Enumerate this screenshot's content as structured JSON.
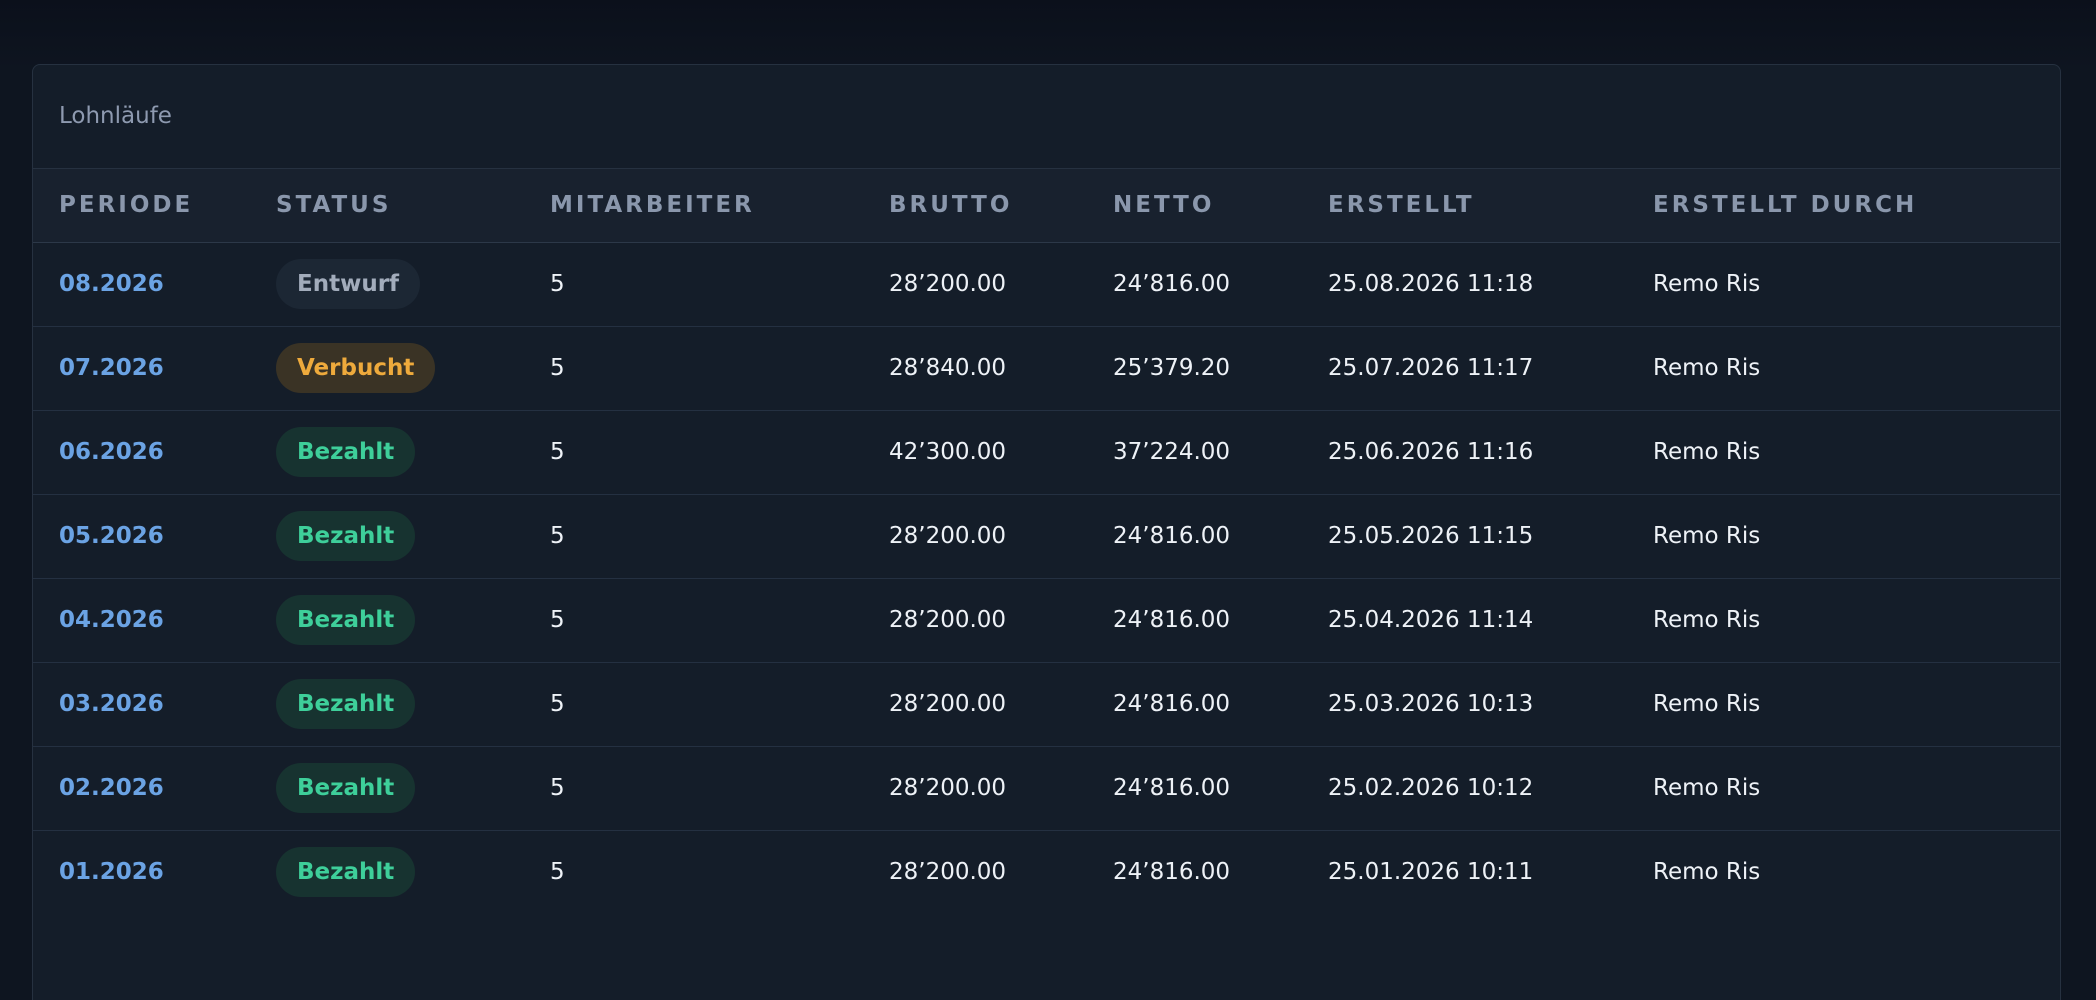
{
  "card": {
    "title": "Lohnläufe"
  },
  "table": {
    "headers": [
      "PERIODE",
      "STATUS",
      "MITARBEITER",
      "BRUTTO",
      "NETTO",
      "ERSTELLT",
      "ERSTELLT DURCH"
    ],
    "rows": [
      {
        "period": "08.2026",
        "status": "Entwurf",
        "status_kind": "draft",
        "employees": "5",
        "gross": "28’200.00",
        "net": "24’816.00",
        "created": "25.08.2026 11:18",
        "created_by": "Remo Ris"
      },
      {
        "period": "07.2026",
        "status": "Verbucht",
        "status_kind": "booked",
        "employees": "5",
        "gross": "28’840.00",
        "net": "25’379.20",
        "created": "25.07.2026 11:17",
        "created_by": "Remo Ris"
      },
      {
        "period": "06.2026",
        "status": "Bezahlt",
        "status_kind": "paid",
        "employees": "5",
        "gross": "42’300.00",
        "net": "37’224.00",
        "created": "25.06.2026 11:16",
        "created_by": "Remo Ris"
      },
      {
        "period": "05.2026",
        "status": "Bezahlt",
        "status_kind": "paid",
        "employees": "5",
        "gross": "28’200.00",
        "net": "24’816.00",
        "created": "25.05.2026 11:15",
        "created_by": "Remo Ris"
      },
      {
        "period": "04.2026",
        "status": "Bezahlt",
        "status_kind": "paid",
        "employees": "5",
        "gross": "28’200.00",
        "net": "24’816.00",
        "created": "25.04.2026 11:14",
        "created_by": "Remo Ris"
      },
      {
        "period": "03.2026",
        "status": "Bezahlt",
        "status_kind": "paid",
        "employees": "5",
        "gross": "28’200.00",
        "net": "24’816.00",
        "created": "25.03.2026 10:13",
        "created_by": "Remo Ris"
      },
      {
        "period": "02.2026",
        "status": "Bezahlt",
        "status_kind": "paid",
        "employees": "5",
        "gross": "28’200.00",
        "net": "24’816.00",
        "created": "25.02.2026 10:12",
        "created_by": "Remo Ris"
      },
      {
        "period": "01.2026",
        "status": "Bezahlt",
        "status_kind": "paid",
        "employees": "5",
        "gross": "28’200.00",
        "net": "24’816.00",
        "created": "25.01.2026 10:11",
        "created_by": "Remo Ris"
      }
    ]
  },
  "colors": {
    "page_background": "#0e1520",
    "card_background": "#141d29",
    "period_link": "#6ba3e4",
    "status_draft": "#a2acbb",
    "status_booked": "#eeaa3c",
    "status_paid": "#3ecf9a"
  }
}
